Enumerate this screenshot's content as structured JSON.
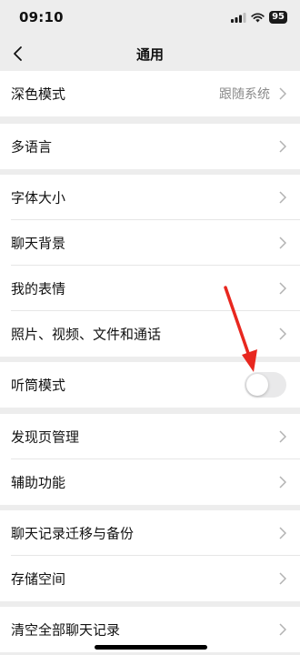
{
  "status_bar": {
    "time": "09:10",
    "battery": "95"
  },
  "nav": {
    "title": "通用",
    "back_icon": "chevron-left-icon"
  },
  "groups": [
    {
      "rows": [
        {
          "label": "深色模式",
          "value": "跟随系统"
        }
      ]
    },
    {
      "rows": [
        {
          "label": "多语言"
        }
      ]
    },
    {
      "rows": [
        {
          "label": "字体大小"
        },
        {
          "label": "聊天背景"
        },
        {
          "label": "我的表情"
        },
        {
          "label": "照片、视频、文件和通话"
        }
      ]
    },
    {
      "rows": [
        {
          "label": "听筒模式",
          "toggle": false
        }
      ]
    },
    {
      "rows": [
        {
          "label": "发现页管理"
        },
        {
          "label": "辅助功能"
        }
      ]
    },
    {
      "rows": [
        {
          "label": "聊天记录迁移与备份"
        },
        {
          "label": "存储空间"
        }
      ]
    },
    {
      "rows": [
        {
          "label": "清空全部聊天记录"
        }
      ]
    }
  ],
  "colors": {
    "background": "#EDEDED",
    "row_bg": "#FFFFFF",
    "chevron": "#B2B2B2",
    "arrow": "#E8271F",
    "toggle_off": "#E9E9EA"
  }
}
